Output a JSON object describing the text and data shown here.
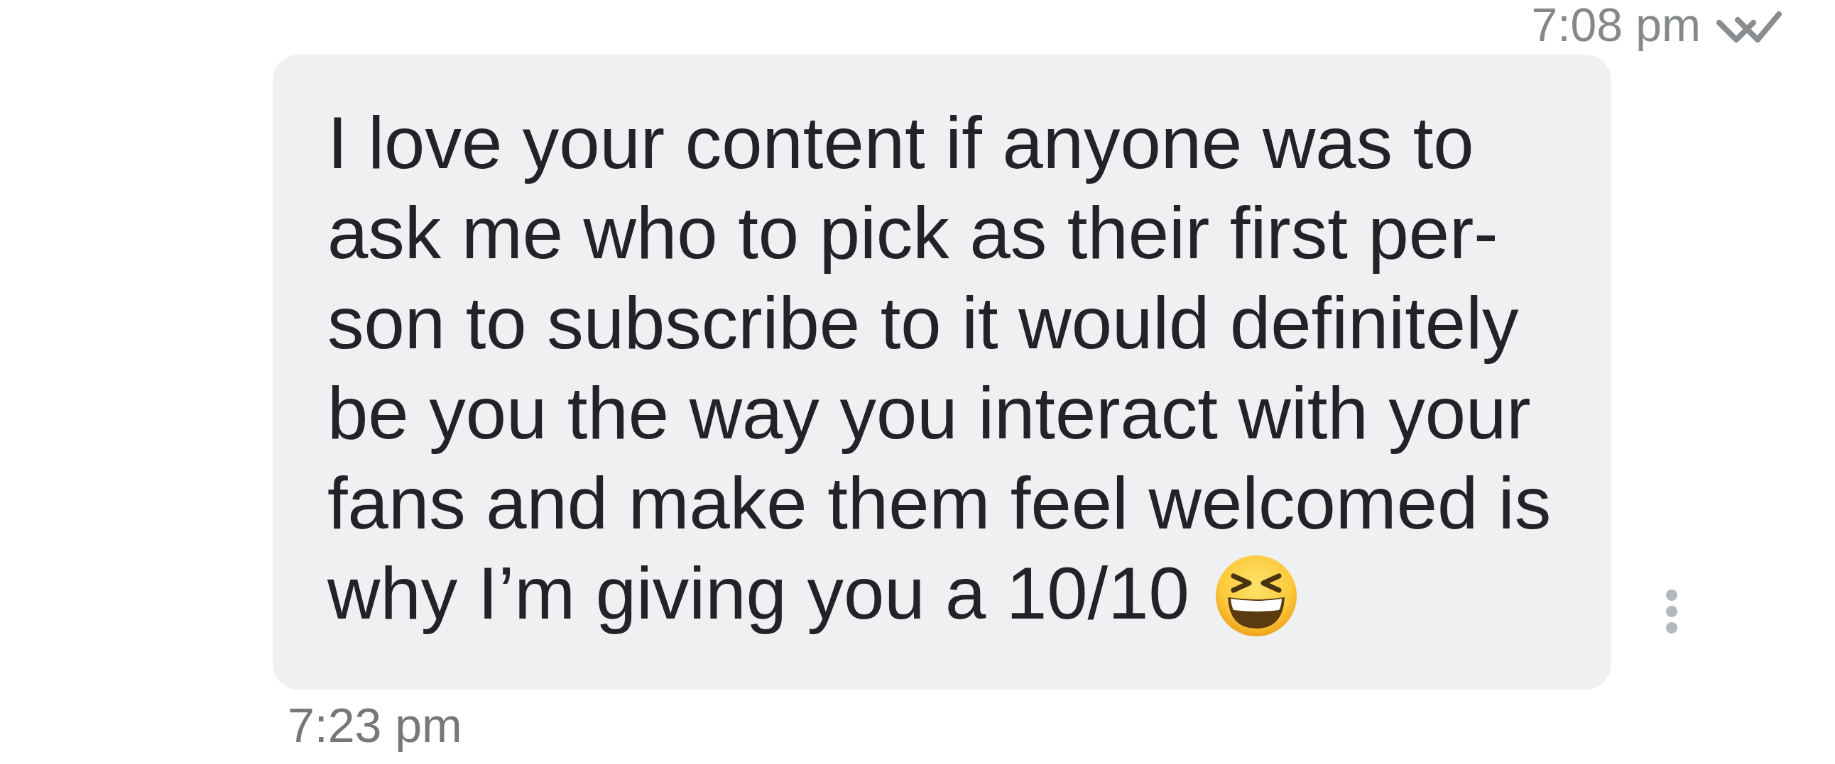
{
  "header": {
    "time": "7:08 pm"
  },
  "message": {
    "lines": [
      "I love your content if anyone was to",
      "ask me who to pick as their first per-",
      "son to subscribe to it would definitely",
      "be you the way you interact with your",
      "fans and make them feel welcomed is",
      "why I’m giving you a 10/10"
    ]
  },
  "footer": {
    "time": "7:23 pm"
  }
}
